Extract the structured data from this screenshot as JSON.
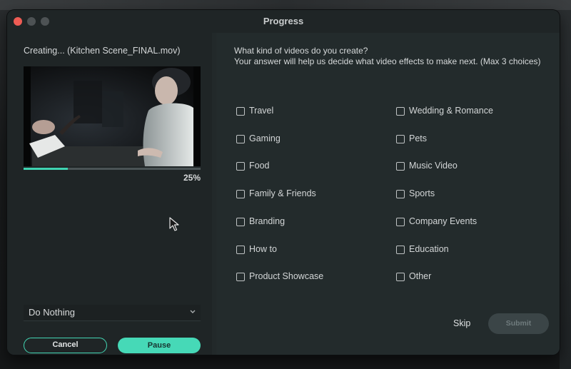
{
  "window": {
    "title": "Progress"
  },
  "left": {
    "creating_text": "Creating... (Kitchen Scene_FINAL.mov)",
    "progress_percent_label": "25%",
    "progress_fraction": 0.25,
    "after_export_select": {
      "value": "Do Nothing"
    },
    "cancel_label": "Cancel",
    "pause_label": "Pause"
  },
  "survey": {
    "question": "What kind of videos do you create?\nYour answer will help us decide what video effects to make next.  (Max 3 choices)",
    "options_left": [
      "Travel",
      "Gaming",
      "Food",
      "Family & Friends",
      "Branding",
      "How to",
      "Product Showcase"
    ],
    "options_right": [
      "Wedding & Romance",
      "Pets",
      "Music Video",
      "Sports",
      "Company Events",
      "Education",
      "Other"
    ],
    "skip_label": "Skip",
    "submit_label": "Submit"
  },
  "colors": {
    "accent": "#46d9b7",
    "close_button": "#ee5c54",
    "panel_left": "#1f2526",
    "panel_right": "#232b2c"
  },
  "icons": [
    "close-window-icon",
    "minimize-window-icon",
    "maximize-window-icon",
    "chevron-down-icon",
    "checkbox-icon",
    "mouse-cursor-icon"
  ]
}
